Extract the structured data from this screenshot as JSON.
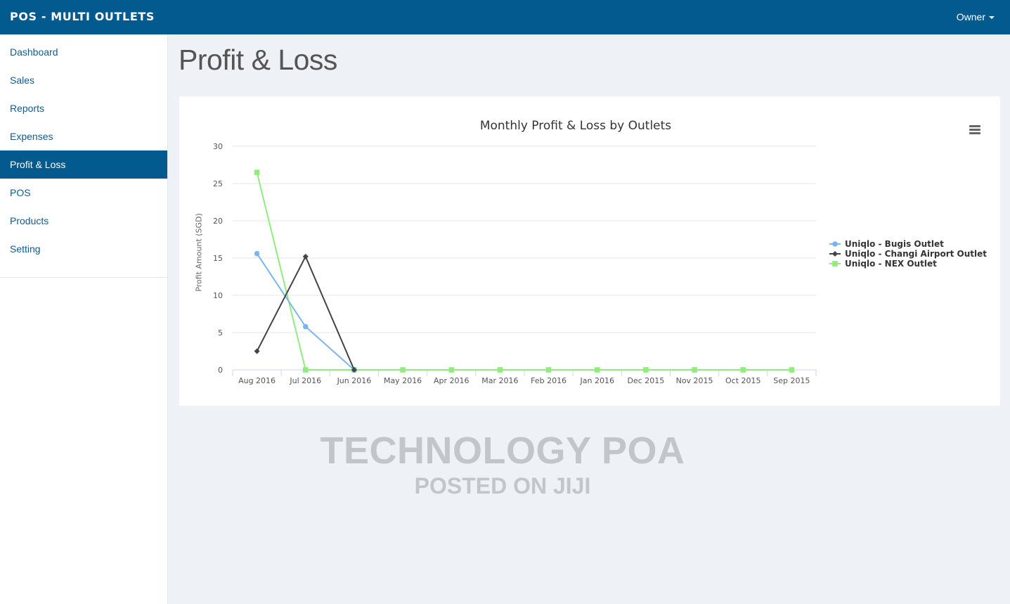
{
  "app": {
    "title": "POS - MULTI OUTLETS",
    "user_menu": "Owner"
  },
  "sidebar": {
    "items": [
      {
        "label": "Dashboard"
      },
      {
        "label": "Sales"
      },
      {
        "label": "Reports"
      },
      {
        "label": "Expenses"
      },
      {
        "label": "Profit & Loss",
        "active": true
      },
      {
        "label": "POS"
      },
      {
        "label": "Products"
      },
      {
        "label": "Setting"
      }
    ]
  },
  "page": {
    "title": "Profit & Loss"
  },
  "colors": {
    "navbar": "#035a8f",
    "bugis": "#7cb5ec",
    "changi": "#434348",
    "nex": "#90ed7d"
  },
  "watermark": {
    "line1": "TECHNOLOGY POA",
    "line2": "POSTED ON JIJI"
  },
  "chart_data": {
    "type": "line",
    "title": "Monthly Profit & Loss by Outlets",
    "xlabel": "",
    "ylabel": "Profit Amount (SGD)",
    "ylim": [
      0,
      30
    ],
    "yticks": [
      0,
      5,
      10,
      15,
      20,
      25,
      30
    ],
    "categories": [
      "Aug 2016",
      "Jul 2016",
      "Jun 2016",
      "May 2016",
      "Apr 2016",
      "Mar 2016",
      "Feb 2016",
      "Jan 2016",
      "Dec 2015",
      "Nov 2015",
      "Oct 2015",
      "Sep 2015"
    ],
    "grid": true,
    "legend": "right",
    "series": [
      {
        "name": "Uniqlo - Bugis Outlet",
        "marker": "circle",
        "values": [
          15.6,
          5.8,
          0,
          null,
          null,
          null,
          null,
          null,
          null,
          null,
          null,
          null
        ]
      },
      {
        "name": "Uniqlo - Changi Airport Outlet",
        "marker": "diamond",
        "values": [
          2.5,
          15.2,
          0,
          null,
          null,
          null,
          null,
          null,
          null,
          null,
          null,
          null
        ]
      },
      {
        "name": "Uniqlo - NEX Outlet",
        "marker": "square",
        "values": [
          26.5,
          0,
          0,
          0,
          0,
          0,
          0,
          0,
          0,
          0,
          0,
          0
        ]
      }
    ]
  }
}
